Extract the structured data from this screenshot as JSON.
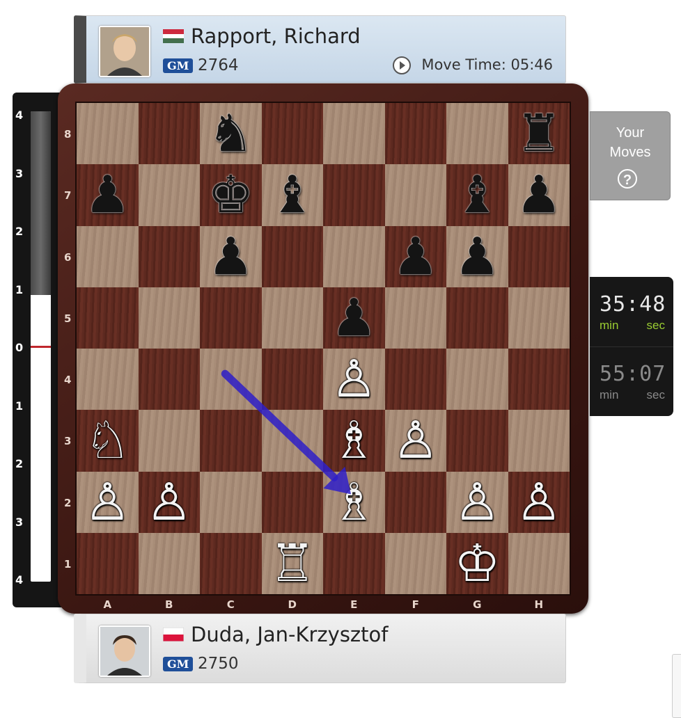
{
  "top_player": {
    "name": "Rapport, Richard",
    "title": "GM",
    "rating": "2764",
    "move_time_label": "Move Time: 05:46",
    "flag": "hungary",
    "avatar_icon": "player-photo"
  },
  "bottom_player": {
    "name": "Duda, Jan-Krzysztof",
    "title": "GM",
    "rating": "2750",
    "flag": "poland",
    "avatar_icon": "player-photo"
  },
  "eval_bar": {
    "tick_labels": [
      "4",
      "3",
      "2",
      "1",
      "0",
      "1",
      "2",
      "3",
      "4"
    ],
    "evaluation": 0.0,
    "marker_color": "#c0272d"
  },
  "board": {
    "ranks": [
      "8",
      "7",
      "6",
      "5",
      "4",
      "3",
      "2",
      "1"
    ],
    "files": [
      "A",
      "B",
      "C",
      "D",
      "E",
      "F",
      "G",
      "H"
    ],
    "pieces": [
      {
        "square": "c8",
        "color": "b",
        "type": "knight"
      },
      {
        "square": "h8",
        "color": "b",
        "type": "rook"
      },
      {
        "square": "a7",
        "color": "b",
        "type": "pawn"
      },
      {
        "square": "c7",
        "color": "b",
        "type": "king"
      },
      {
        "square": "d7",
        "color": "b",
        "type": "bishop"
      },
      {
        "square": "g7",
        "color": "b",
        "type": "bishop"
      },
      {
        "square": "h7",
        "color": "b",
        "type": "pawn"
      },
      {
        "square": "c6",
        "color": "b",
        "type": "pawn"
      },
      {
        "square": "f6",
        "color": "b",
        "type": "pawn"
      },
      {
        "square": "g6",
        "color": "b",
        "type": "pawn"
      },
      {
        "square": "e5",
        "color": "b",
        "type": "pawn"
      },
      {
        "square": "e4",
        "color": "w",
        "type": "pawn"
      },
      {
        "square": "a3",
        "color": "w",
        "type": "knight"
      },
      {
        "square": "e3",
        "color": "w",
        "type": "bishop"
      },
      {
        "square": "f3",
        "color": "w",
        "type": "pawn"
      },
      {
        "square": "a2",
        "color": "w",
        "type": "pawn"
      },
      {
        "square": "b2",
        "color": "w",
        "type": "pawn"
      },
      {
        "square": "e2",
        "color": "w",
        "type": "bishop"
      },
      {
        "square": "g2",
        "color": "w",
        "type": "pawn"
      },
      {
        "square": "h2",
        "color": "w",
        "type": "pawn"
      },
      {
        "square": "d1",
        "color": "w",
        "type": "rook"
      },
      {
        "square": "g1",
        "color": "w",
        "type": "king"
      }
    ],
    "arrow": {
      "from": "c4",
      "to": "e2",
      "color": "#2f1fc8"
    }
  },
  "your_moves": {
    "label_line1": "Your",
    "label_line2": "Moves",
    "help_glyph": "?"
  },
  "clocks": {
    "top": {
      "digits": "35:48",
      "min_label": "min",
      "sec_label": "sec",
      "color": "#e8e8e8",
      "unit_color": "#9acd32"
    },
    "bottom": {
      "digits": "55:07",
      "min_label": "min",
      "sec_label": "sec",
      "color": "#8a8a8a",
      "unit_color": "#8a8a8a"
    }
  }
}
